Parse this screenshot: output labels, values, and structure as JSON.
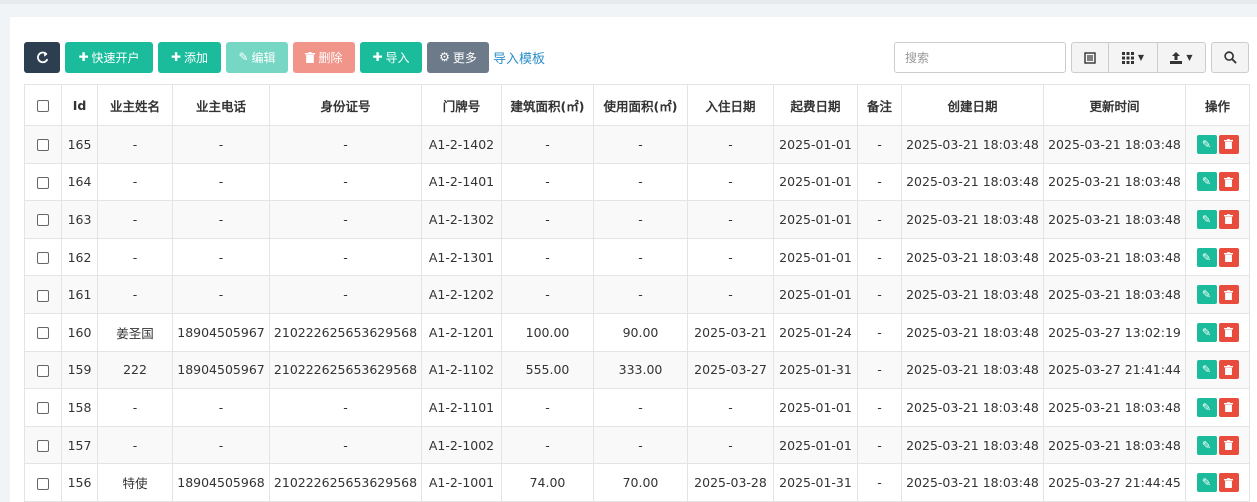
{
  "toolbar": {
    "quick_open": "快速开户",
    "add": "添加",
    "edit": "编辑",
    "delete": "删除",
    "import": "导入",
    "more": "更多",
    "import_template": "导入模板"
  },
  "search": {
    "placeholder": "搜索"
  },
  "table": {
    "headers": [
      "Id",
      "业主姓名",
      "业主电话",
      "身份证号",
      "门牌号",
      "建筑面积(㎡)",
      "使用面积(㎡)",
      "入住日期",
      "起费日期",
      "备注",
      "创建日期",
      "更新时间",
      "操作"
    ],
    "rows": [
      [
        "165",
        "-",
        "-",
        "-",
        "A1-2-1402",
        "-",
        "-",
        "-",
        "2025-01-01",
        "-",
        "2025-03-21 18:03:48",
        "2025-03-21 18:03:48"
      ],
      [
        "164",
        "-",
        "-",
        "-",
        "A1-2-1401",
        "-",
        "-",
        "-",
        "2025-01-01",
        "-",
        "2025-03-21 18:03:48",
        "2025-03-21 18:03:48"
      ],
      [
        "163",
        "-",
        "-",
        "-",
        "A1-2-1302",
        "-",
        "-",
        "-",
        "2025-01-01",
        "-",
        "2025-03-21 18:03:48",
        "2025-03-21 18:03:48"
      ],
      [
        "162",
        "-",
        "-",
        "-",
        "A1-2-1301",
        "-",
        "-",
        "-",
        "2025-01-01",
        "-",
        "2025-03-21 18:03:48",
        "2025-03-21 18:03:48"
      ],
      [
        "161",
        "-",
        "-",
        "-",
        "A1-2-1202",
        "-",
        "-",
        "-",
        "2025-01-01",
        "-",
        "2025-03-21 18:03:48",
        "2025-03-21 18:03:48"
      ],
      [
        "160",
        "姜圣国",
        "18904505967",
        "210222625653629568",
        "A1-2-1201",
        "100.00",
        "90.00",
        "2025-03-21",
        "2025-01-24",
        "-",
        "2025-03-21 18:03:48",
        "2025-03-27 13:02:19"
      ],
      [
        "159",
        "222",
        "18904505967",
        "210222625653629568",
        "A1-2-1102",
        "555.00",
        "333.00",
        "2025-03-27",
        "2025-01-31",
        "-",
        "2025-03-21 18:03:48",
        "2025-03-27 21:41:44"
      ],
      [
        "158",
        "-",
        "-",
        "-",
        "A1-2-1101",
        "-",
        "-",
        "-",
        "2025-01-01",
        "-",
        "2025-03-21 18:03:48",
        "2025-03-21 18:03:48"
      ],
      [
        "157",
        "-",
        "-",
        "-",
        "A1-2-1002",
        "-",
        "-",
        "-",
        "2025-01-01",
        "-",
        "2025-03-21 18:03:48",
        "2025-03-21 18:03:48"
      ],
      [
        "156",
        "特使",
        "18904505968",
        "210222625653629568",
        "A1-2-1001",
        "74.00",
        "70.00",
        "2025-03-28",
        "2025-01-31",
        "-",
        "2025-03-21 18:03:48",
        "2025-03-27 21:44:45"
      ]
    ]
  },
  "icons": {
    "refresh": "refresh-icon",
    "plus": "plus-icon",
    "pencil": "pencil-icon",
    "trash": "trash-icon",
    "gear": "gear-icon",
    "list": "list-icon",
    "grid": "grid-icon",
    "export": "export-icon",
    "search": "search-icon"
  },
  "colors": {
    "primary_dark": "#2c3e50",
    "teal": "#1abc9c",
    "red": "#e74c3c",
    "gray": "#6c7a89",
    "link": "#2c8fca"
  }
}
